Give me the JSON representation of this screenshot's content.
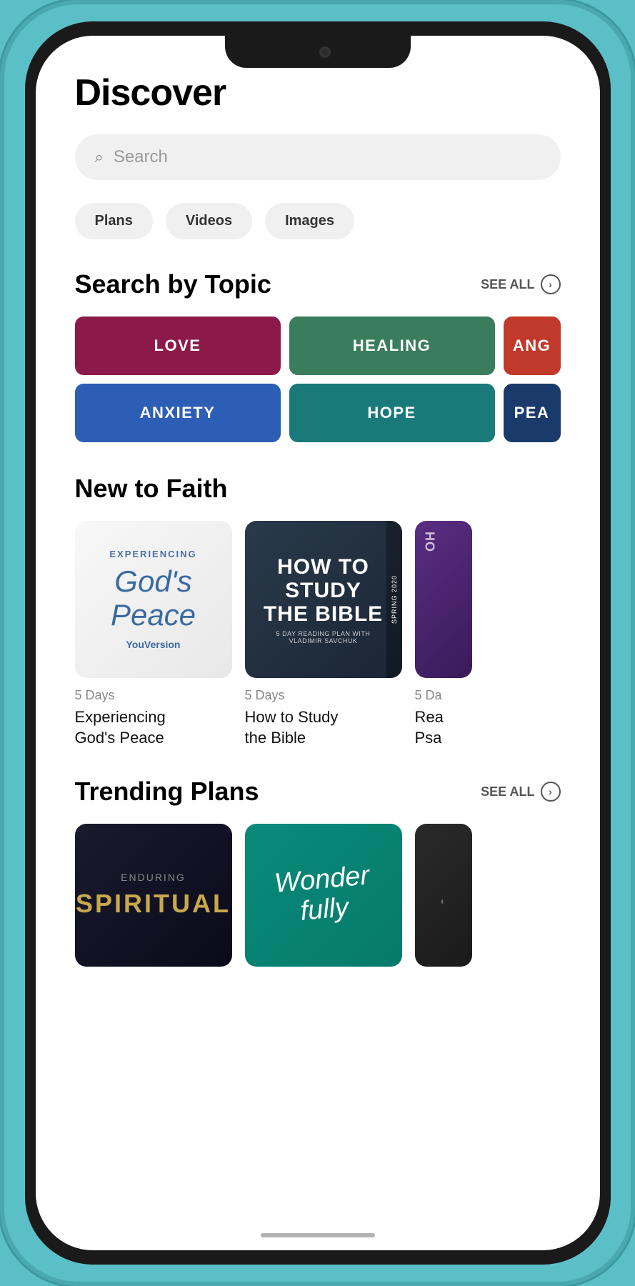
{
  "app": {
    "title": "Discover"
  },
  "search": {
    "placeholder": "Search"
  },
  "filters": {
    "items": [
      "Plans",
      "Videos",
      "Images"
    ]
  },
  "search_by_topic": {
    "section_title": "Search by Topic",
    "see_all_label": "SEE ALL",
    "topics": [
      {
        "id": "love",
        "label": "LOVE",
        "color": "#8b1a4a",
        "class": "topic-love"
      },
      {
        "id": "healing",
        "label": "HEALING",
        "color": "#3a7d5c",
        "class": "topic-healing"
      },
      {
        "id": "anger",
        "label": "ANG",
        "color": "#c0392b",
        "class": "topic-anger"
      },
      {
        "id": "anxiety",
        "label": "ANXIETY",
        "color": "#2c5eb5",
        "class": "topic-anxiety"
      },
      {
        "id": "hope",
        "label": "HOPE",
        "color": "#1a7a7a",
        "class": "topic-hope"
      },
      {
        "id": "peace",
        "label": "PEA",
        "color": "#1a3a6b",
        "class": "topic-peace"
      }
    ]
  },
  "new_to_faith": {
    "section_title": "New to Faith",
    "plans": [
      {
        "id": "gods-peace",
        "days": "5 Days",
        "title": "Experiencing God's Peace",
        "title_line1": "Experiencing",
        "title_line2": "God's Peace"
      },
      {
        "id": "study-bible",
        "days": "5 Days",
        "title": "How to Study the Bible",
        "title_line1": "How to Study",
        "title_line2": "the Bible"
      },
      {
        "id": "partial",
        "days": "5 Da",
        "title": "Rea\nPsa"
      }
    ],
    "peace_plan": {
      "top_label": "EXPERIENCING",
      "main_title_1": "God's",
      "main_title_2": "Peace",
      "brand": "YouVersion"
    },
    "bible_plan": {
      "title_line1": "HOW TO",
      "title_line2": "STUDY",
      "title_line3": "THE BIBLE",
      "subtitle": "5 DAY READING PLAN WITH VLADIMIR SAVCHUK",
      "spring_tag": "SPRING 2020"
    }
  },
  "trending_plans": {
    "section_title": "Trending Plans",
    "see_all_label": "SEE ALL",
    "plans": [
      {
        "id": "spiritual",
        "top_text": "ENDURING",
        "main_text": "SPIRITUAL"
      },
      {
        "id": "wonderfully",
        "text_line1": "Wonder",
        "text_line2": "fully"
      }
    ]
  },
  "icons": {
    "search": "🔍",
    "circle_arrow": "›"
  }
}
